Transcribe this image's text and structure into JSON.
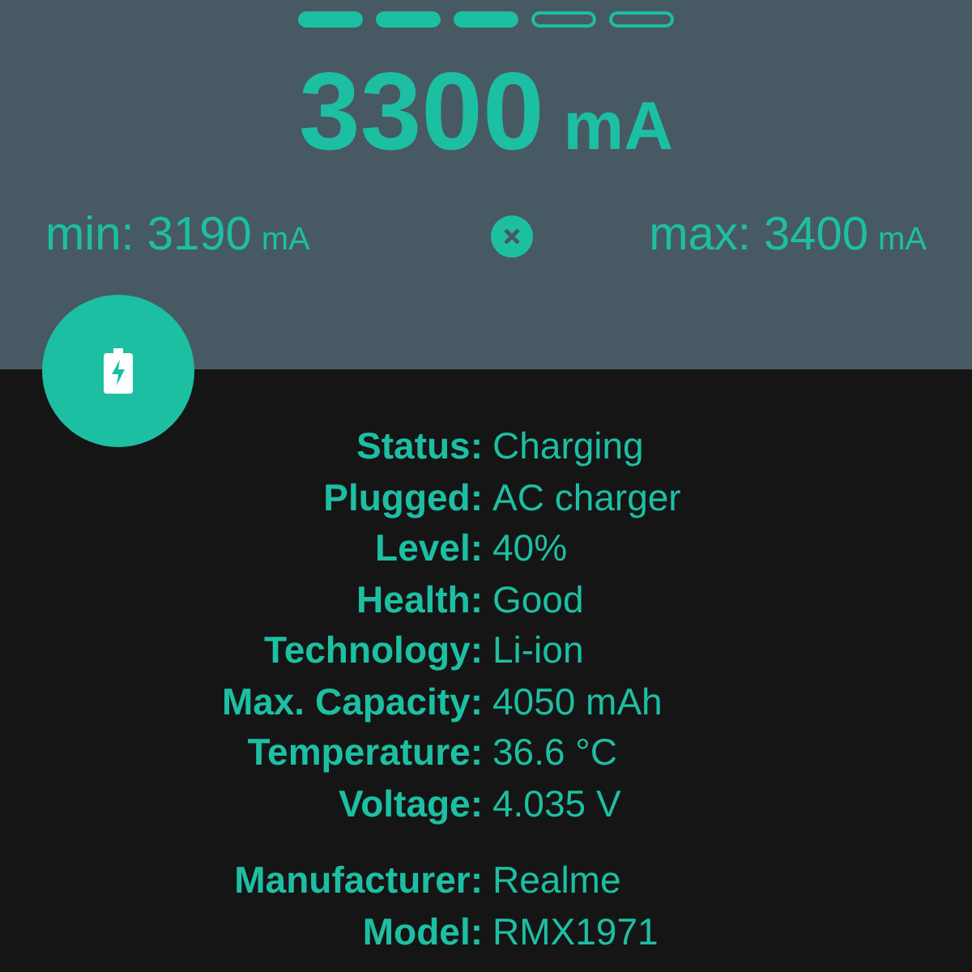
{
  "page_indicator": [
    {
      "selected": true
    },
    {
      "selected": true
    },
    {
      "selected": true
    },
    {
      "selected": false
    },
    {
      "selected": false
    }
  ],
  "current": {
    "value": "3300",
    "unit": "mA"
  },
  "min": {
    "label": "min: 3190",
    "unit": "mA"
  },
  "max": {
    "label": "max: 3400",
    "unit": "mA"
  },
  "info_groups": [
    [
      {
        "label": "Status:",
        "value": "Charging"
      },
      {
        "label": "Plugged:",
        "value": "AC charger"
      },
      {
        "label": "Level:",
        "value": "40%"
      },
      {
        "label": "Health:",
        "value": "Good"
      },
      {
        "label": "Technology:",
        "value": "Li-ion"
      },
      {
        "label": "Max. Capacity:",
        "value": "4050 mAh"
      },
      {
        "label": "Temperature:",
        "value": "36.6 °C"
      },
      {
        "label": "Voltage:",
        "value": "4.035 V"
      }
    ],
    [
      {
        "label": "Manufacturer:",
        "value": "Realme"
      },
      {
        "label": "Model:",
        "value": "RMX1971"
      }
    ]
  ]
}
